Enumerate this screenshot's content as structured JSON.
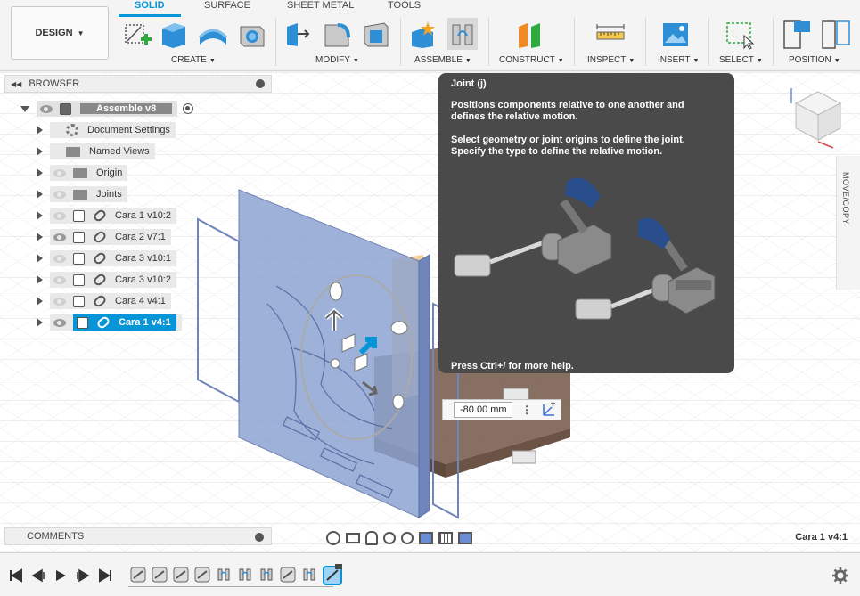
{
  "toolbar": {
    "workspace_label": "DESIGN",
    "tabs": [
      "SOLID",
      "SURFACE",
      "SHEET METAL",
      "TOOLS"
    ],
    "groups": [
      "CREATE",
      "MODIFY",
      "ASSEMBLE",
      "CONSTRUCT",
      "INSPECT",
      "INSERT",
      "SELECT",
      "POSITION"
    ]
  },
  "browser": {
    "title": "BROWSER",
    "root": "Assemble v8",
    "items": [
      {
        "label": "Document Settings",
        "type": "settings"
      },
      {
        "label": "Named Views",
        "type": "folder"
      },
      {
        "label": "Origin",
        "type": "folder"
      },
      {
        "label": "Joints",
        "type": "folder"
      },
      {
        "label": "Cara 1 v10:2",
        "type": "component"
      },
      {
        "label": "Cara 2 v7:1",
        "type": "component"
      },
      {
        "label": "Cara 3 v10:1",
        "type": "component"
      },
      {
        "label": "Cara 3 v10:2",
        "type": "component"
      },
      {
        "label": "Cara 4 v4:1",
        "type": "component"
      },
      {
        "label": "Cara 1 v4:1",
        "type": "component",
        "selected": true
      }
    ]
  },
  "tooltip": {
    "title": "Joint (j)",
    "line1": "Positions components relative to one another and",
    "line2": "defines the relative motion.",
    "line3": "Select geometry or joint origins to define the joint.",
    "line4": "Specify the type to define the relative motion.",
    "footer": "Press Ctrl+/ for more help."
  },
  "dimension": {
    "value": "-80.00 mm"
  },
  "comments": {
    "title": "COMMENTS"
  },
  "side_panel": {
    "label": "MOVE/COPY"
  },
  "status": {
    "selection": "Cara 1 v4:1"
  },
  "colors": {
    "accent": "#0696d7",
    "part_blue": "#8ea4d2",
    "part_brown": "#7a6150"
  }
}
